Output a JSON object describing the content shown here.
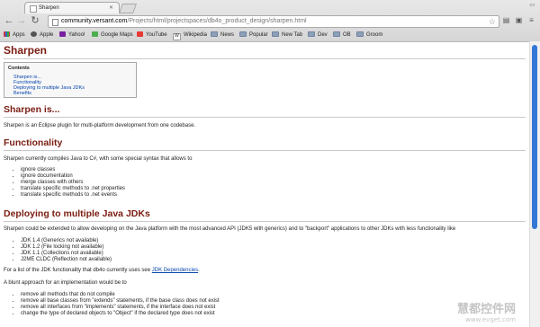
{
  "browser": {
    "tab_title": "Sharpen",
    "url_host": "community.versant.com",
    "url_path": "/Projects/html/projectspaces/db4o_product_design/sharpen.html",
    "bookmarks": [
      "Apps",
      "Apple",
      "Yahoo!",
      "Google Maps",
      "YouTube",
      "Wikipedia",
      "News",
      "Popular",
      "New Tab",
      "Dev",
      "OB",
      "Groom"
    ]
  },
  "page": {
    "title": "Sharpen",
    "toc_title": "Contents",
    "toc": [
      "Sharpen is...",
      "Functionality",
      "Deploying to multiple Java JDKs",
      "Benefits"
    ],
    "s1_heading": "Sharpen is...",
    "s1_text": "Sharpen is an Eclipse plugin for multi-platform development from one codebase.",
    "s2_heading": "Functionality",
    "s2_text": "Sharpen currently compiles Java to C#, with some special syntax that allows to",
    "s2_items": [
      "ignore classes",
      "ignore documentation",
      "merge classes with others",
      "translate specific methods to .net properties",
      "translate specific methods to .net events"
    ],
    "s3_heading": "Deploying to multiple Java JDKs",
    "s3_text": "Sharpen could be extended to allow developing on the Java platform with the most advanced API (JDK5 with generics) and to \"backport\" applications to other JDKs with less functionality like",
    "s3_items": [
      "JDK 1.4 (Generics not available)",
      "JDK 1.2 (File locking not available)",
      "JDK 1.1 (Collections not available)",
      "J2ME CLDC (Reflection not available)"
    ],
    "s3_list_text": "For a list of the JDK functionality that db4o currently uses see",
    "s3_link": "JDK Dependencies",
    "s3_period": ".",
    "s3_approach": "A blunt approach for an implementation would be to",
    "s3_items2": [
      "remove all methods that do not compile",
      "remove all base classes from \"extends\" statements, if the base class does not exist",
      "remove all interfaces from \"implements\" statements, if the interface does not exist",
      "change the type of declared objects to \"Object\" if the declared type does not exist"
    ]
  },
  "watermark": {
    "main": "慧都控件网",
    "sub": "www.evget.com"
  }
}
